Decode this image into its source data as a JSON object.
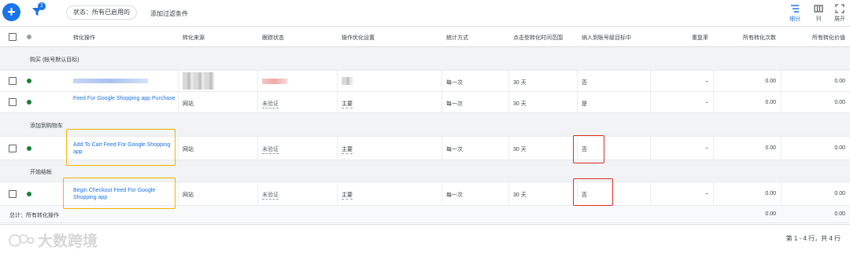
{
  "toolbar": {
    "add_icon": "plus-icon",
    "filter_icon": "filter-icon",
    "filter_count": "1",
    "status_chip": "状态：所有已启用的",
    "add_filter": "添加过滤条件",
    "views": [
      {
        "label": "细分",
        "icon": "segment-icon"
      },
      {
        "label": "列",
        "icon": "columns-icon"
      },
      {
        "label": "展开",
        "icon": "expand-icon"
      }
    ]
  },
  "columns": [
    "转化操作",
    "转化来源",
    "跟踪状态",
    "操作优化设置",
    "统计方式",
    "点击型转化时间范围",
    "纳入到账号级目标中",
    "重复率",
    "所有转化次数",
    "所有转化价值"
  ],
  "sections": [
    {
      "label": "购买 (帐号默认目标)",
      "rows": [
        {
          "name": "",
          "source": "",
          "tracking": "",
          "optimization": "",
          "count": "每一次",
          "window": "30 天",
          "include": "否",
          "repeat": "–",
          "conversions": "0.00",
          "value": "0.00"
        },
        {
          "name": "Feed For Google Shopping app Purchase",
          "source": "网站",
          "tracking": "未验证",
          "optimization": "主要",
          "count": "每一次",
          "window": "30 天",
          "include": "是",
          "repeat": "–",
          "conversions": "0.00",
          "value": "0.00"
        }
      ]
    },
    {
      "label": "添加到购物车",
      "rows": [
        {
          "name": "Add To Cart Feed For Google Shopping app",
          "source": "网站",
          "tracking": "未验证",
          "optimization": "主要",
          "count": "每一次",
          "window": "30 天",
          "include": "否",
          "repeat": "–",
          "conversions": "0.00",
          "value": "0.00"
        }
      ]
    },
    {
      "label": "开始结帐",
      "rows": [
        {
          "name": "Begin Checkout Feed For Google Shopping app",
          "source": "网站",
          "tracking": "未验证",
          "optimization": "主要",
          "count": "每一次",
          "window": "30 天",
          "include": "否",
          "repeat": "–",
          "conversions": "0.00",
          "value": "0.00"
        }
      ]
    }
  ],
  "total": {
    "label": "总计：所有转化操作",
    "conversions": "0.00",
    "value": "0.00"
  },
  "pagination": "第 1 - 4 行，共 4 行",
  "watermark": "大数跨境",
  "colors": {
    "accent": "#1a73e8",
    "status_green": "#188038",
    "highlight_yellow": "#f4b400",
    "highlight_red": "#d93025"
  }
}
